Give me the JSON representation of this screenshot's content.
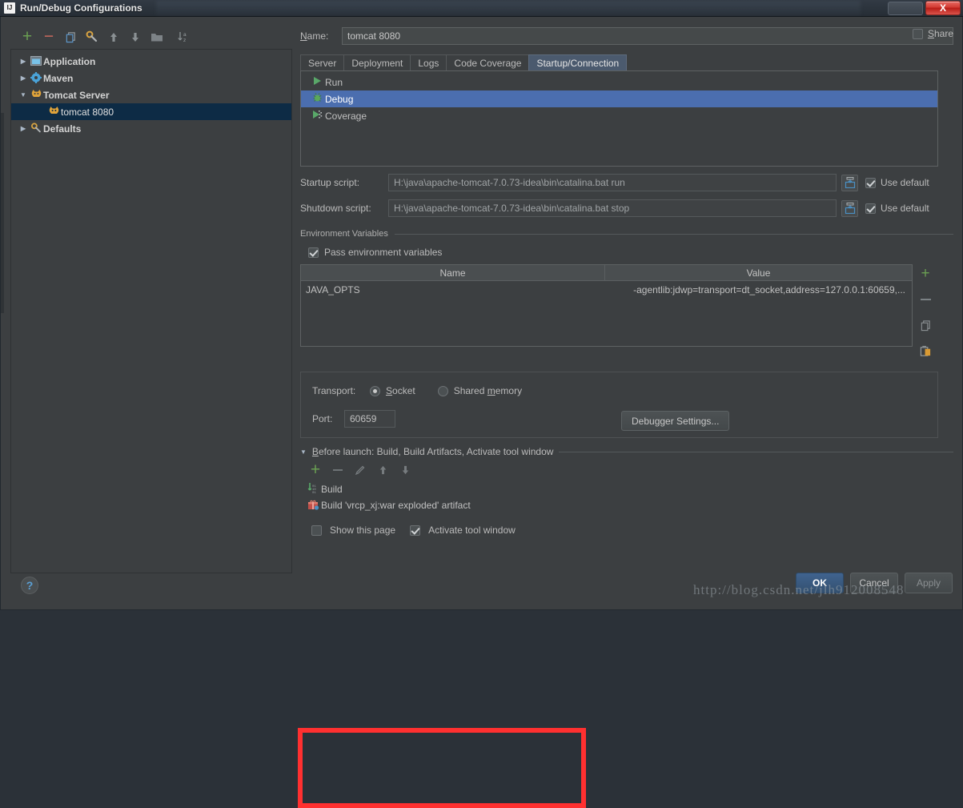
{
  "window": {
    "title": "Run/Debug Configurations",
    "app_icon": "intellij-idea-icon",
    "close_label": "X"
  },
  "left_panel": {
    "toolbar": [
      {
        "name": "add-configuration-button",
        "icon": "plus-icon",
        "glyph": "+"
      },
      {
        "name": "remove-configuration-button",
        "icon": "minus-icon",
        "glyph": "−"
      },
      {
        "name": "copy-configuration-button",
        "icon": "copy-icon",
        "glyph": ""
      },
      {
        "name": "edit-defaults-button",
        "icon": "wrench-icon",
        "glyph": ""
      },
      {
        "name": "move-up-button",
        "icon": "arrow-up-icon",
        "glyph": ""
      },
      {
        "name": "move-down-button",
        "icon": "arrow-down-icon",
        "glyph": ""
      },
      {
        "name": "create-folder-button",
        "icon": "folder-icon",
        "glyph": ""
      },
      {
        "name": "sort-configurations-button",
        "icon": "sort-az-icon",
        "glyph": ""
      }
    ],
    "tree": [
      {
        "label": "Application",
        "icon": "application-icon",
        "arrow": "▶",
        "group": true,
        "selected": false,
        "indent": 0
      },
      {
        "label": "Maven",
        "icon": "maven-gear-icon",
        "arrow": "▶",
        "group": true,
        "selected": false,
        "indent": 0
      },
      {
        "label": "Tomcat Server",
        "icon": "tomcat-cat-icon",
        "arrow": "▼",
        "group": true,
        "selected": false,
        "indent": 0
      },
      {
        "label": "tomcat 8080",
        "icon": "tomcat-cat-icon",
        "arrow": "",
        "group": false,
        "selected": true,
        "indent": 1
      },
      {
        "label": "Defaults",
        "icon": "wrench-icon",
        "arrow": "▶",
        "group": true,
        "selected": false,
        "indent": 0
      }
    ]
  },
  "header": {
    "name_label": "Name:",
    "name_mnemonic": "N",
    "name_value": "tomcat 8080",
    "share_label": "Share",
    "share_mnemonic": "S",
    "share_checked": false
  },
  "tabs": [
    {
      "label": "Server",
      "active": false
    },
    {
      "label": "Deployment",
      "active": false
    },
    {
      "label": "Logs",
      "active": false
    },
    {
      "label": "Code Coverage",
      "active": false
    },
    {
      "label": "Startup/Connection",
      "active": true
    }
  ],
  "startup_connection": {
    "modes": [
      {
        "label": "Run",
        "icon": "run-triangle-icon",
        "selected": false
      },
      {
        "label": "Debug",
        "icon": "debug-bug-icon",
        "selected": true
      },
      {
        "label": "Coverage",
        "icon": "coverage-icon",
        "selected": false
      }
    ],
    "startup_script": {
      "label": "Startup script:",
      "value": "H:\\java\\apache-tomcat-7.0.73-idea\\bin\\catalina.bat run",
      "browse_icon": "insert-default-icon",
      "use_default_label": "Use default",
      "use_default_checked": true
    },
    "shutdown_script": {
      "label": "Shutdown script:",
      "value": "H:\\java\\apache-tomcat-7.0.73-idea\\bin\\catalina.bat stop",
      "browse_icon": "insert-default-icon",
      "use_default_label": "Use default",
      "use_default_checked": true
    },
    "env_group_title": "Environment Variables",
    "pass_env_label": "Pass environment variables",
    "pass_env_checked": true,
    "env_table": {
      "columns": [
        "Name",
        "Value"
      ],
      "rows": [
        {
          "name": "JAVA_OPTS",
          "value": "-agentlib:jdwp=transport=dt_socket,address=127.0.0.1:60659,..."
        }
      ],
      "side_buttons": [
        {
          "name": "env-add-button",
          "icon": "plus-icon",
          "glyph": "+"
        },
        {
          "name": "env-remove-button",
          "icon": "minus-icon",
          "glyph": "−"
        },
        {
          "name": "env-copy-button",
          "icon": "copy-icon",
          "glyph": ""
        },
        {
          "name": "env-paste-button",
          "icon": "paste-icon",
          "glyph": ""
        }
      ]
    },
    "transport": {
      "label": "Transport:",
      "options": [
        {
          "label": "Socket",
          "mnemonic": "S",
          "selected": true
        },
        {
          "label": "Shared memory",
          "mnemonic": "m",
          "selected": false
        }
      ],
      "port_label": "Port:",
      "port_value": "60659",
      "debugger_settings_label": "Debugger Settings..."
    }
  },
  "before_launch": {
    "title": "Before launch: Build, Build Artifacts, Activate tool window",
    "mnemonic": "B",
    "toolbar": [
      {
        "name": "before-launch-add-button",
        "icon": "plus-icon",
        "glyph": "+"
      },
      {
        "name": "before-launch-remove-button",
        "icon": "minus-icon",
        "glyph": "−"
      },
      {
        "name": "before-launch-edit-button",
        "icon": "pencil-icon",
        "glyph": ""
      },
      {
        "name": "before-launch-move-up-button",
        "icon": "arrow-up-icon",
        "glyph": ""
      },
      {
        "name": "before-launch-move-down-button",
        "icon": "arrow-down-icon",
        "glyph": ""
      }
    ],
    "items": [
      {
        "label": "Build",
        "icon": "build-icon"
      },
      {
        "label": "Build 'vrcp_xj:war exploded' artifact",
        "icon": "artifact-icon"
      }
    ],
    "show_page_label": "Show this page",
    "show_page_checked": false,
    "activate_tool_window_label": "Activate tool window",
    "activate_tool_window_checked": true
  },
  "footer": {
    "help_label": "?",
    "ok_label": "OK",
    "cancel_label": "Cancel",
    "apply_label": "Apply"
  },
  "watermark": "http://blog.csdn.net/jlh912008548",
  "colors": {
    "accent_selection": "#4b6eaf",
    "tree_selection": "#0d2b45",
    "annotation_red": "#ff3030",
    "panel_bg": "#3c3f41",
    "green_plus": "#6a9e52",
    "red_minus": "#c86a5e"
  }
}
